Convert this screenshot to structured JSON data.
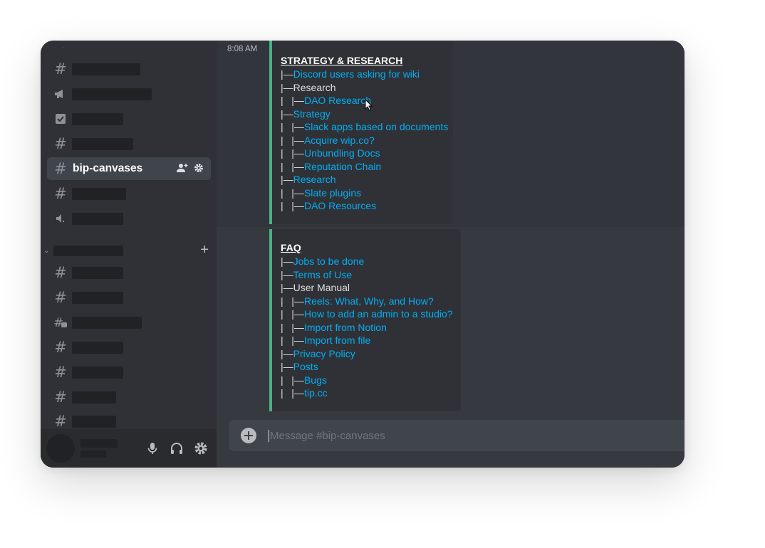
{
  "sidebar": {
    "top_indicator": "· ·",
    "channels": [
      {
        "icon": "hashtag-icon",
        "glyph": "#",
        "label": "",
        "bar": 96
      },
      {
        "icon": "megaphone-icon",
        "glyph": "📢",
        "label": "",
        "bar": 112
      },
      {
        "icon": "checkbox-icon",
        "glyph": "☑",
        "label": "",
        "bar": 72
      },
      {
        "icon": "hashtag-icon",
        "glyph": "#",
        "label": "",
        "bar": 86
      },
      {
        "icon": "hashtag-icon",
        "glyph": "#",
        "label": "bip-canvases",
        "active": true
      },
      {
        "icon": "hashtag-icon",
        "glyph": "#",
        "label": "",
        "bar": 76
      },
      {
        "icon": "speaker-icon",
        "glyph": "🔈",
        "label": "",
        "bar": 72
      }
    ],
    "category": {
      "chevron": "⌄",
      "plus": "+"
    },
    "channels2": [
      {
        "icon": "hashtag-icon",
        "glyph": "#",
        "bar": 72
      },
      {
        "icon": "hashtag-icon",
        "glyph": "#",
        "bar": 72
      },
      {
        "icon": "thread-channel-icon",
        "glyph": "#",
        "bar": 98
      },
      {
        "icon": "hashtag-icon",
        "glyph": "#",
        "bar": 72
      },
      {
        "icon": "hashtag-icon",
        "glyph": "#",
        "bar": 72
      },
      {
        "icon": "hashtag-icon",
        "glyph": "#",
        "bar": 62
      },
      {
        "icon": "hashtag-icon",
        "glyph": "#",
        "bar": 62
      }
    ]
  },
  "chat": {
    "timestamp": "8:08 AM",
    "embed1": {
      "title": "STRATEGY & RESEARCH",
      "lines": [
        {
          "prefix": "|—",
          "text": "Discord users asking for wiki",
          "link": true
        },
        {
          "prefix": "|—",
          "text": "Research",
          "link": false
        },
        {
          "prefix": "|   |—",
          "text": "DAO Research",
          "link": true
        },
        {
          "prefix": "|—",
          "text": "Strategy",
          "link": true
        },
        {
          "prefix": "|   |—",
          "text": "Slack apps based on documents",
          "link": true
        },
        {
          "prefix": "|   |—",
          "text": "Acquire wip.co?",
          "link": true
        },
        {
          "prefix": "|   |—",
          "text": "Unbundling Docs",
          "link": true
        },
        {
          "prefix": "|   |—",
          "text": "Reputation Chain",
          "link": true
        },
        {
          "prefix": "|—",
          "text": "Research",
          "link": true
        },
        {
          "prefix": "|   |—",
          "text": "Slate plugins",
          "link": true
        },
        {
          "prefix": "|   |—",
          "text": "DAO Resources",
          "link": true
        }
      ]
    },
    "embed2": {
      "title": "FAQ",
      "lines": [
        {
          "prefix": "|—",
          "text": "Jobs to be done",
          "link": true
        },
        {
          "prefix": "|—",
          "text": "Terms of Use",
          "link": true
        },
        {
          "prefix": "|—",
          "text": "User Manual",
          "link": false
        },
        {
          "prefix": "|   |—",
          "text": "Reels: What, Why, and How?",
          "link": true
        },
        {
          "prefix": "|   |—",
          "text": "How to add an admin to a studio?",
          "link": true
        },
        {
          "prefix": "|   |—",
          "text": "Import from Notion",
          "link": true
        },
        {
          "prefix": "|   |—",
          "text": "Import from file",
          "link": true
        },
        {
          "prefix": "|—",
          "text": "Privacy Policy",
          "link": true
        },
        {
          "prefix": "|—",
          "text": "Posts",
          "link": true
        },
        {
          "prefix": "|   |—",
          "text": "Bugs",
          "link": true
        },
        {
          "prefix": "|   |—",
          "text": "tip.cc",
          "link": true
        }
      ]
    },
    "input": {
      "placeholder": "Message #bip-canvases"
    }
  },
  "colors": {
    "sidebar": "#2f3136",
    "chat": "#36393f",
    "embed_accent": "#43b581",
    "link": "#00b0f4"
  }
}
